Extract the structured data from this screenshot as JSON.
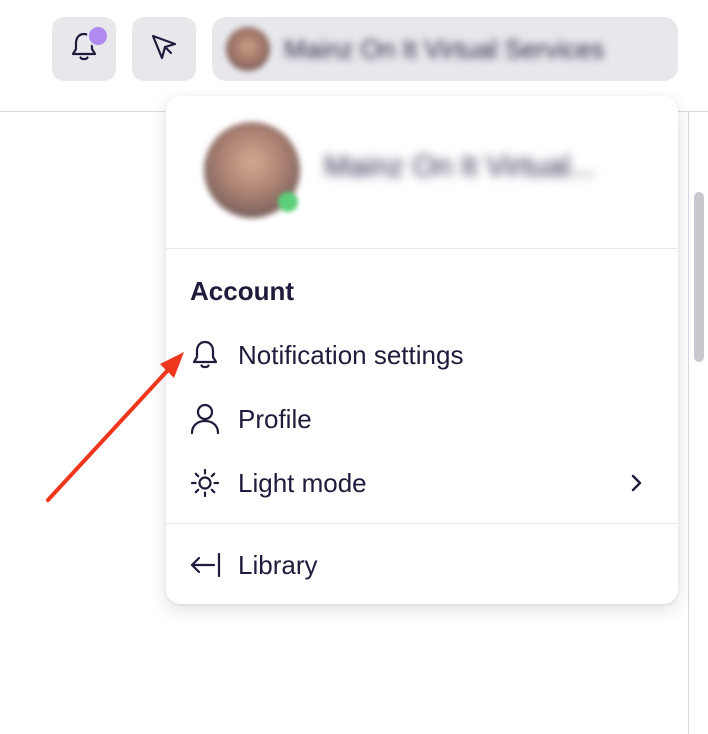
{
  "header": {
    "account_name": "Mainz On It Virtual Services",
    "notification_dot_color": "#b08af0"
  },
  "menu": {
    "user_name": "Mainz On It Virtual...",
    "section_title": "Account",
    "items": [
      {
        "label": "Notification settings",
        "icon": "bell-icon"
      },
      {
        "label": "Profile",
        "icon": "user-icon"
      },
      {
        "label": "Light mode",
        "icon": "sun-icon",
        "has_submenu": true
      },
      {
        "label": "Library",
        "icon": "arrow-left-bar-icon"
      }
    ]
  },
  "annotation": {
    "arrow_color": "#f0361c"
  }
}
